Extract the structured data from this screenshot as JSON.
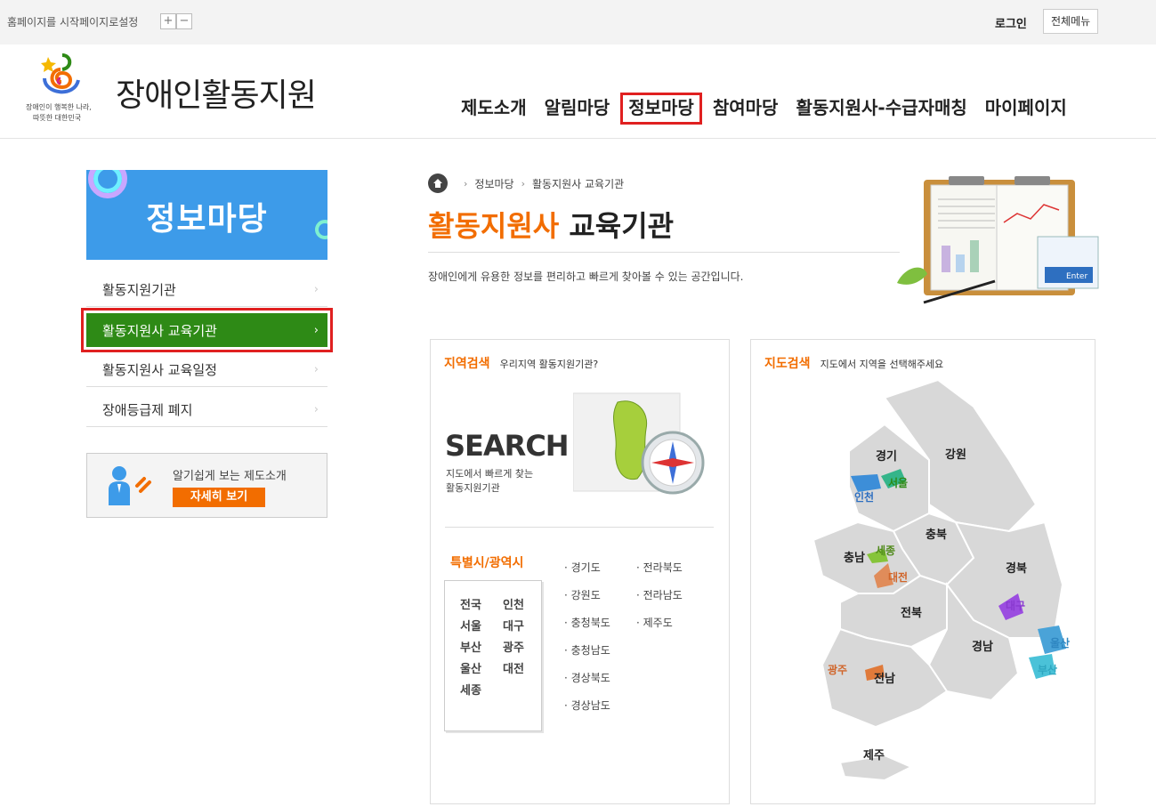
{
  "topbar": {
    "homepage_setting": "홈페이지를 시작페이지로설정",
    "zoom_in": "+",
    "zoom_out": "−",
    "login": "로그인",
    "all_menu": "전체메뉴"
  },
  "logo": {
    "title": "장애인활동지원",
    "slogan_line1": "장애인이 행복한 나라,",
    "slogan_line2": "따뜻한 대한민국"
  },
  "gnb": {
    "items": [
      {
        "label": "제도소개"
      },
      {
        "label": "알림마당"
      },
      {
        "label": "정보마당",
        "active": true
      },
      {
        "label": "참여마당"
      },
      {
        "label": "활동지원사-수급자매칭"
      },
      {
        "label": "마이페이지"
      }
    ]
  },
  "sidebar": {
    "banner_title": "정보마당",
    "items": [
      {
        "label": "활동지원기관",
        "chevron": "›"
      },
      {
        "label": "활동지원사 교육기관",
        "chevron": "›",
        "active": true
      },
      {
        "label": "활동지원사 교육일정",
        "chevron": "›"
      },
      {
        "label": "장애등급제 폐지",
        "chevron": "›"
      }
    ],
    "guide": {
      "label": "알기쉽게 보는 제도소개",
      "button": "자세히 보기"
    }
  },
  "breadcrumb": {
    "items": [
      "정보마당",
      "활동지원사 교육기관"
    ],
    "separator": "›"
  },
  "page": {
    "title_highlight": "활동지원사",
    "title_rest": " 교육기관",
    "description": "장애인에게 유용한 정보를 편리하고 빠르게 찾아볼 수 있는 공간입니다."
  },
  "region_search": {
    "title": "지역검색",
    "subtitle": "우리지역 활동지원기관?",
    "big_text": "SEARCH",
    "sub_line1": "지도에서 빠르게 찾는",
    "sub_line2": "활동지원기관",
    "metro_title": "특별시/광역시",
    "metro": [
      "전국",
      "인천",
      "서울",
      "대구",
      "부산",
      "광주",
      "울산",
      "대전",
      "세종"
    ],
    "provinces_col1": [
      "· 경기도",
      "· 강원도",
      "· 충청북도",
      "· 충청남도",
      "· 경상북도",
      "· 경상남도"
    ],
    "provinces_col2": [
      "· 전라북도",
      "· 전라남도",
      "· 제주도"
    ]
  },
  "map_search": {
    "title": "지도검색",
    "subtitle": "지도에서 지역을 선택해주세요",
    "labels": {
      "gyeonggi": "경기",
      "gangwon": "강원",
      "seoul": "서울",
      "incheon": "인천",
      "chungbuk": "충북",
      "chungnam": "충남",
      "sejong": "세종",
      "daejeon": "대전",
      "gyeongbuk": "경북",
      "daegu": "대구",
      "jeonbuk": "전북",
      "ulsan": "울산",
      "gyeongnam": "경남",
      "busan": "부산",
      "gwangju": "광주",
      "jeonnam": "전남",
      "jeju": "제주"
    }
  },
  "colors": {
    "accent_orange": "#f26d00",
    "active_green": "#2e8a16",
    "highlight_red": "#e02020",
    "banner_blue": "#3d9be9"
  }
}
